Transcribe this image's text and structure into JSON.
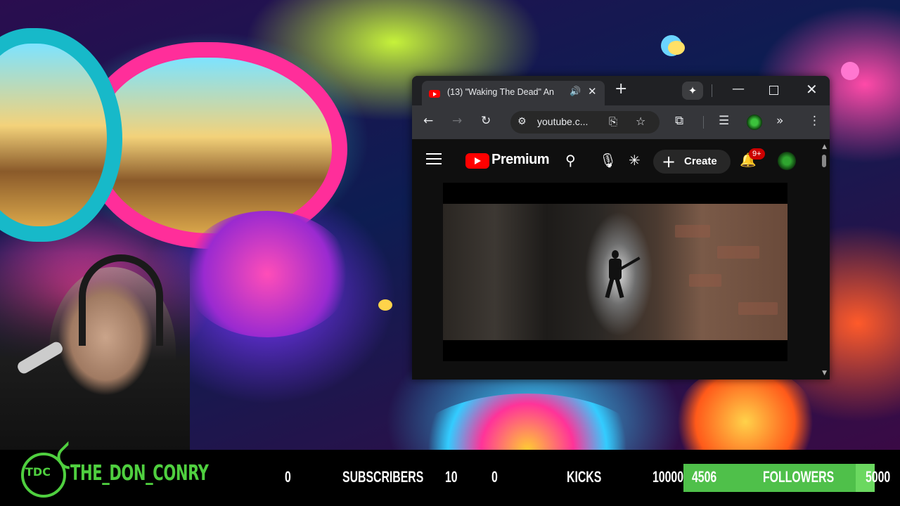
{
  "browser": {
    "tab": {
      "favicon": "youtube-icon",
      "title": "(13) \"Waking The Dead\" An",
      "audio_icon": "speaker-icon"
    },
    "window_controls": [
      "minimize-icon",
      "maximize-icon",
      "close-icon"
    ],
    "address_bar": {
      "url": "youtube.c..."
    },
    "toolbar_icons": [
      "back-icon",
      "forward-icon",
      "reload-icon",
      "site-settings-icon",
      "install-icon",
      "bookmark-star-icon",
      "extensions-icon",
      "reading-list-icon",
      "profile-avatar",
      "more-chevron-icon",
      "menu-dots-icon"
    ]
  },
  "youtube": {
    "logo_label": "Premium",
    "create_label": "Create",
    "notification_badge": "9+",
    "icons": [
      "menu-icon",
      "search-icon",
      "mic-icon",
      "gemini-icon",
      "bell-icon"
    ]
  },
  "stats_bar": {
    "logo_text": "TDC",
    "channel_name": "THE_DON_CONRY",
    "subscribers": {
      "current": "0",
      "label": "SUBSCRIBERS",
      "goal": "10"
    },
    "kicks": {
      "current": "0",
      "label": "KICKS",
      "goal": "10000"
    },
    "followers": {
      "current": "4506",
      "label": "FOLLOWERS",
      "goal": "5000",
      "progress_fraction": 0.9
    },
    "accent_color": "#4fcf3f"
  }
}
